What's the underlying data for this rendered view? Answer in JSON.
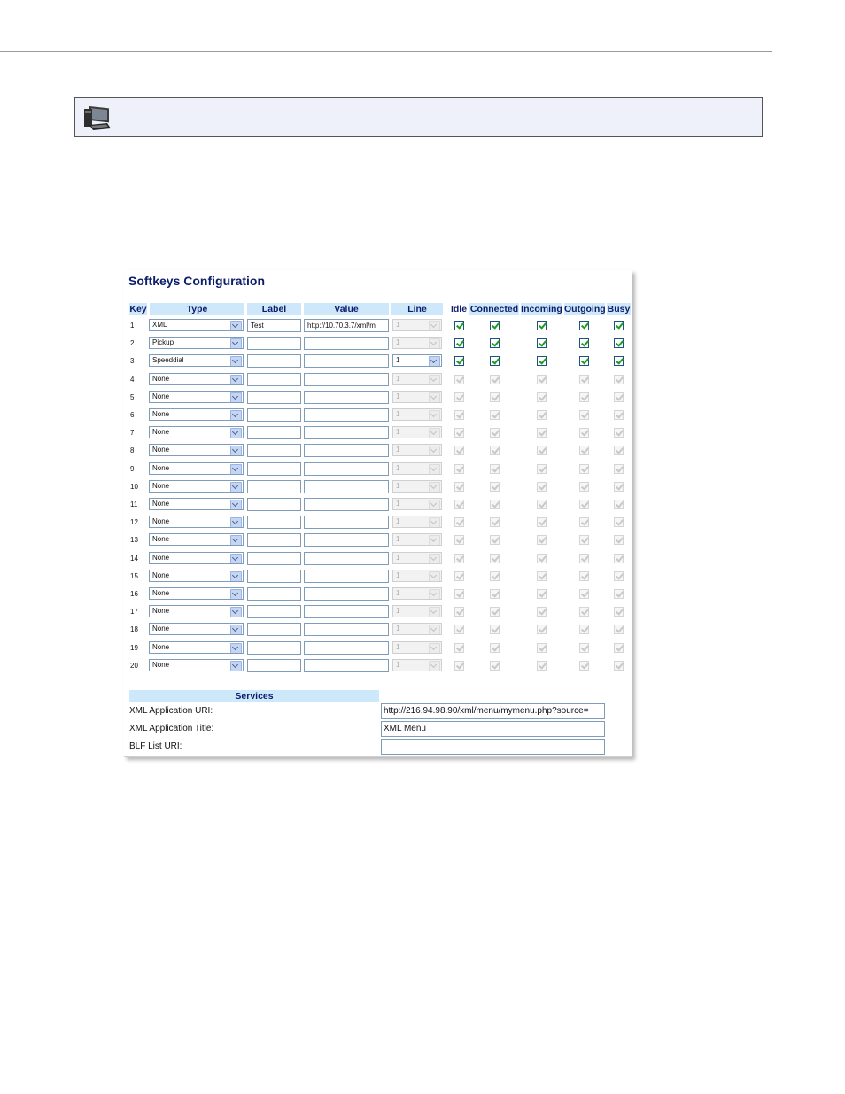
{
  "panel": {
    "title": "Softkeys Configuration",
    "headers": {
      "key": "Key",
      "type": "Type",
      "label": "Label",
      "value": "Value",
      "line": "Line",
      "idle": "Idle",
      "connected": "Connected",
      "incoming": "Incoming",
      "outgoing": "Outgoing",
      "busy": "Busy"
    },
    "rows": [
      {
        "key": "1",
        "type": "XML",
        "label": "Test",
        "value": "http://10.70.3.7/xml/m",
        "line": "1",
        "line_enabled": false,
        "states_enabled": true,
        "states": [
          true,
          true,
          true,
          true,
          true
        ]
      },
      {
        "key": "2",
        "type": "Pickup",
        "label": "",
        "value": "",
        "line": "1",
        "line_enabled": false,
        "states_enabled": true,
        "states": [
          true,
          true,
          true,
          true,
          true
        ]
      },
      {
        "key": "3",
        "type": "Speeddial",
        "label": "",
        "value": "",
        "line": "1",
        "line_enabled": true,
        "states_enabled": true,
        "states": [
          true,
          true,
          true,
          true,
          true
        ]
      },
      {
        "key": "4",
        "type": "None",
        "label": "",
        "value": "",
        "line": "1",
        "line_enabled": false,
        "states_enabled": false,
        "states": [
          true,
          true,
          true,
          true,
          true
        ]
      },
      {
        "key": "5",
        "type": "None",
        "label": "",
        "value": "",
        "line": "1",
        "line_enabled": false,
        "states_enabled": false,
        "states": [
          true,
          true,
          true,
          true,
          true
        ]
      },
      {
        "key": "6",
        "type": "None",
        "label": "",
        "value": "",
        "line": "1",
        "line_enabled": false,
        "states_enabled": false,
        "states": [
          true,
          true,
          true,
          true,
          true
        ]
      },
      {
        "key": "7",
        "type": "None",
        "label": "",
        "value": "",
        "line": "1",
        "line_enabled": false,
        "states_enabled": false,
        "states": [
          true,
          true,
          true,
          true,
          true
        ]
      },
      {
        "key": "8",
        "type": "None",
        "label": "",
        "value": "",
        "line": "1",
        "line_enabled": false,
        "states_enabled": false,
        "states": [
          true,
          true,
          true,
          true,
          true
        ]
      },
      {
        "key": "9",
        "type": "None",
        "label": "",
        "value": "",
        "line": "1",
        "line_enabled": false,
        "states_enabled": false,
        "states": [
          true,
          true,
          true,
          true,
          true
        ]
      },
      {
        "key": "10",
        "type": "None",
        "label": "",
        "value": "",
        "line": "1",
        "line_enabled": false,
        "states_enabled": false,
        "states": [
          true,
          true,
          true,
          true,
          true
        ]
      },
      {
        "key": "11",
        "type": "None",
        "label": "",
        "value": "",
        "line": "1",
        "line_enabled": false,
        "states_enabled": false,
        "states": [
          true,
          true,
          true,
          true,
          true
        ]
      },
      {
        "key": "12",
        "type": "None",
        "label": "",
        "value": "",
        "line": "1",
        "line_enabled": false,
        "states_enabled": false,
        "states": [
          true,
          true,
          true,
          true,
          true
        ]
      },
      {
        "key": "13",
        "type": "None",
        "label": "",
        "value": "",
        "line": "1",
        "line_enabled": false,
        "states_enabled": false,
        "states": [
          true,
          true,
          true,
          true,
          true
        ]
      },
      {
        "key": "14",
        "type": "None",
        "label": "",
        "value": "",
        "line": "1",
        "line_enabled": false,
        "states_enabled": false,
        "states": [
          true,
          true,
          true,
          true,
          true
        ]
      },
      {
        "key": "15",
        "type": "None",
        "label": "",
        "value": "",
        "line": "1",
        "line_enabled": false,
        "states_enabled": false,
        "states": [
          true,
          true,
          true,
          true,
          true
        ]
      },
      {
        "key": "16",
        "type": "None",
        "label": "",
        "value": "",
        "line": "1",
        "line_enabled": false,
        "states_enabled": false,
        "states": [
          true,
          true,
          true,
          true,
          true
        ]
      },
      {
        "key": "17",
        "type": "None",
        "label": "",
        "value": "",
        "line": "1",
        "line_enabled": false,
        "states_enabled": false,
        "states": [
          true,
          true,
          true,
          true,
          true
        ]
      },
      {
        "key": "18",
        "type": "None",
        "label": "",
        "value": "",
        "line": "1",
        "line_enabled": false,
        "states_enabled": false,
        "states": [
          true,
          true,
          true,
          true,
          true
        ]
      },
      {
        "key": "19",
        "type": "None",
        "label": "",
        "value": "",
        "line": "1",
        "line_enabled": false,
        "states_enabled": false,
        "states": [
          true,
          true,
          true,
          true,
          true
        ]
      },
      {
        "key": "20",
        "type": "None",
        "label": "",
        "value": "",
        "line": "1",
        "line_enabled": false,
        "states_enabled": false,
        "states": [
          true,
          true,
          true,
          true,
          true
        ]
      }
    ],
    "services": {
      "header": "Services",
      "xml_uri_label": "XML Application URI:",
      "xml_uri_value": "http://216.94.98.90/xml/menu/mymenu.php?source=",
      "xml_title_label": "XML Application Title:",
      "xml_title_value": "XML Menu",
      "blf_label": "BLF List URI:",
      "blf_value": ""
    }
  },
  "note": {
    "icon": "computer-icon"
  },
  "colors": {
    "header_bg": "#cde8fb",
    "title": "#0b1d6b",
    "note_bg": "#eef0fa",
    "check": "#1f9a1f"
  }
}
